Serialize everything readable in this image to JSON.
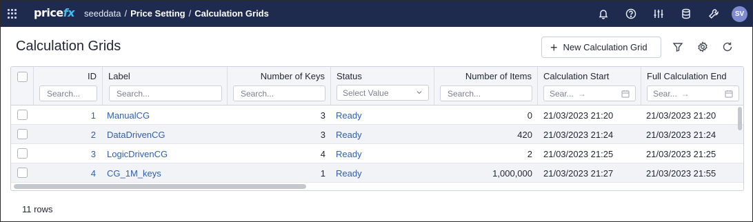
{
  "topbar": {
    "logo_main": "price",
    "logo_accent": "fx",
    "breadcrumb": [
      "seeddata",
      "Price Setting",
      "Calculation Grids"
    ],
    "separator": "/",
    "icons": [
      "apps-grid-icon",
      "bell-icon",
      "help-icon",
      "sliders-icon",
      "database-icon",
      "wrench-icon"
    ],
    "avatar_initials": "SV"
  },
  "page": {
    "title": "Calculation Grids",
    "new_button_label": "New Calculation Grid",
    "header_icons": [
      "filter-icon",
      "settings-icon",
      "refresh-icon"
    ]
  },
  "grid": {
    "columns": [
      {
        "key": "id",
        "label": "ID",
        "filter_placeholder": "Search..."
      },
      {
        "key": "label",
        "label": "Label",
        "filter_placeholder": "Search..."
      },
      {
        "key": "keys",
        "label": "Number of Keys",
        "filter_placeholder": "Search..."
      },
      {
        "key": "status",
        "label": "Status",
        "filter_placeholder": "Select Value"
      },
      {
        "key": "items",
        "label": "Number of Items",
        "filter_placeholder": "Search..."
      },
      {
        "key": "calc_start",
        "label": "Calculation Start",
        "filter_placeholder": "Sear..."
      },
      {
        "key": "full_calc_end",
        "label": "Full Calculation End",
        "filter_placeholder": "Sear..."
      }
    ],
    "date_range_arrow": "→",
    "rows": [
      {
        "id": "1",
        "label": "ManualCG",
        "keys": "3",
        "status": "Ready",
        "items": "0",
        "calc_start": "21/03/2023 21:20",
        "full_calc_end": "21/03/2023 21:20"
      },
      {
        "id": "2",
        "label": "DataDrivenCG",
        "keys": "3",
        "status": "Ready",
        "items": "420",
        "calc_start": "21/03/2023 21:24",
        "full_calc_end": "21/03/2023 21:24"
      },
      {
        "id": "3",
        "label": "LogicDrivenCG",
        "keys": "4",
        "status": "Ready",
        "items": "2",
        "calc_start": "21/03/2023 21:25",
        "full_calc_end": "21/03/2023 21:25"
      },
      {
        "id": "4",
        "label": "CG_1M_keys",
        "keys": "1",
        "status": "Ready",
        "items": "1,000,000",
        "calc_start": "21/03/2023 21:27",
        "full_calc_end": "21/03/2023 21:55"
      }
    ]
  },
  "footer": {
    "row_count": "11 rows"
  },
  "colors": {
    "topbar_bg": "#1e2a4e",
    "logo_accent": "#3fc1f0",
    "link": "#2e5fb3",
    "avatar_bg": "#7f8ad1"
  }
}
